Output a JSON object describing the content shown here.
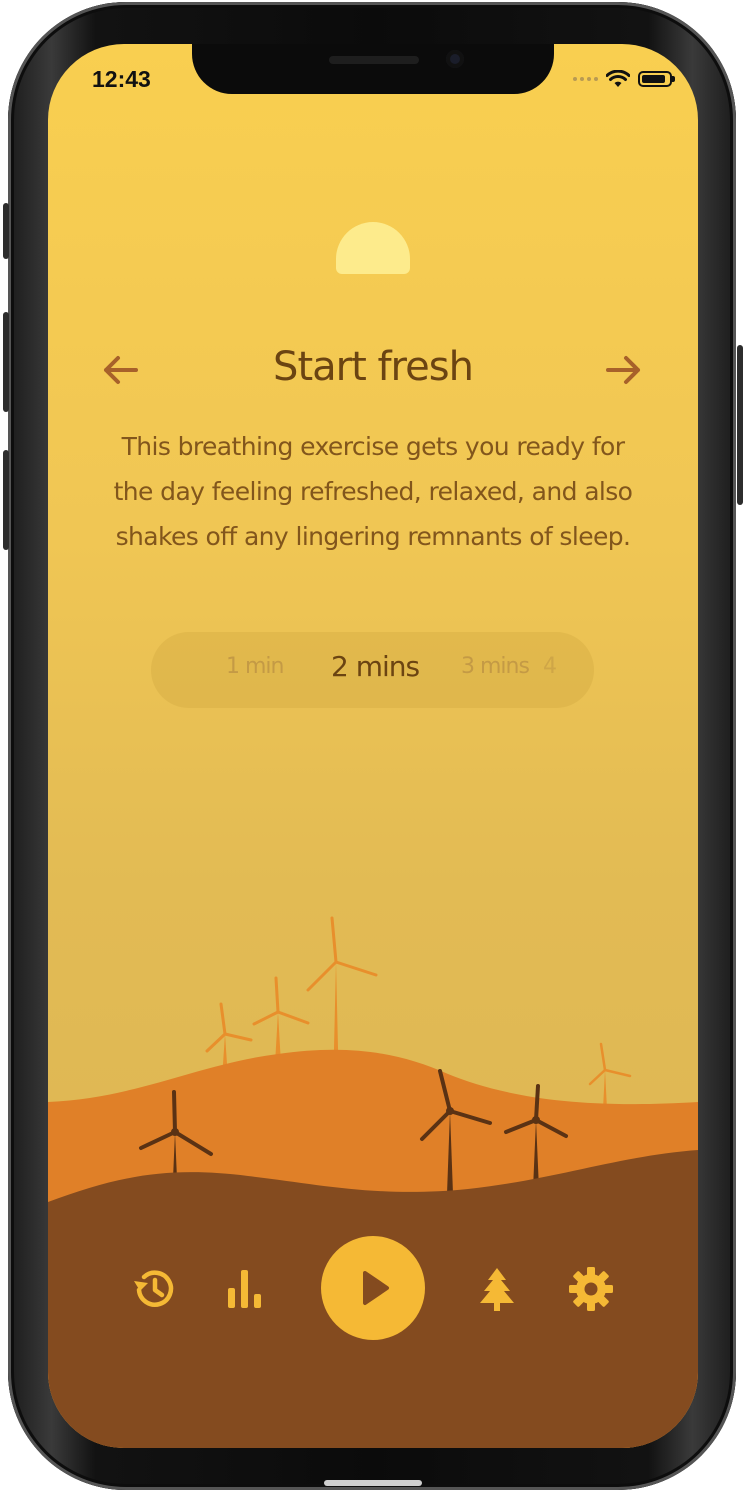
{
  "status_bar": {
    "time": "12:43",
    "battery_level": 0.9
  },
  "exercise": {
    "title": "Start fresh",
    "description": "This breathing exercise gets you ready for the day feeling refreshed, relaxed, and also shakes off any lingering remnants of sleep."
  },
  "duration_picker": {
    "options": [
      "1 min",
      "2 mins",
      "3 mins",
      "4"
    ],
    "selected": "2 mins"
  },
  "icons": {
    "prev": "arrow-left-icon",
    "next": "arrow-right-icon",
    "history": "history-icon",
    "stats": "bar-chart-icon",
    "play": "play-icon",
    "tree": "tree-icon",
    "settings": "gear-icon"
  },
  "colors": {
    "sky_top": "#f9cf50",
    "sky_bottom": "#dcb453",
    "sun": "#fdeb8c",
    "hill_orange": "#e08028",
    "hill_brown": "#844b1f",
    "turbine_light": "#e88f2c",
    "turbine_dark": "#5a3214",
    "accent": "#f5b935",
    "title_text": "#6b4412",
    "body_text": "#82561c"
  }
}
